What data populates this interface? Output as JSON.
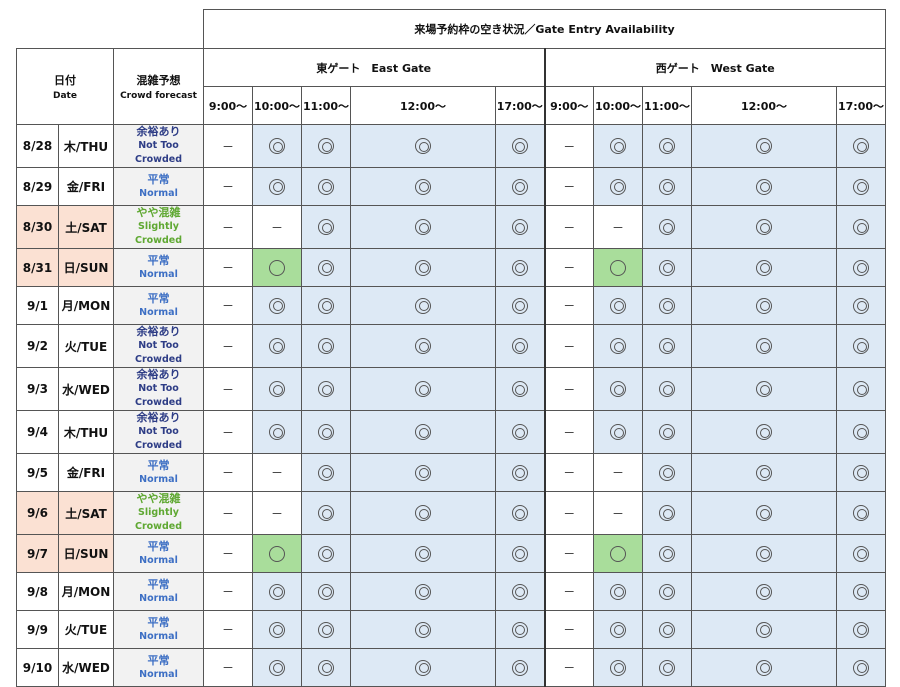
{
  "table": {
    "title": "来場予約枠の空き状況／Gate Entry Availability",
    "header": {
      "date_jp": "日付",
      "date_en": "Date",
      "forecast_jp": "混雑予想",
      "forecast_en": "Crowd forecast"
    },
    "gates": [
      {
        "label": "東ゲート　East Gate"
      },
      {
        "label": "西ゲート　West Gate"
      }
    ],
    "time_slots": [
      "9:00～",
      "10:00～",
      "11:00～",
      "12:00～",
      "17:00～"
    ],
    "legend_symbols": {
      "double_circle": "◎",
      "circle": "○",
      "dash": "－"
    },
    "rows": [
      {
        "date": "8/28",
        "dow": "木/THU",
        "weekend": false,
        "forecast_jp": "余裕あり",
        "forecast_en": "Not Too Crowded",
        "forecast_level": "relaxed",
        "east": [
          "dash",
          "double_circle",
          "double_circle",
          "double_circle",
          "double_circle"
        ],
        "west": [
          "dash",
          "double_circle",
          "double_circle",
          "double_circle",
          "double_circle"
        ]
      },
      {
        "date": "8/29",
        "dow": "金/FRI",
        "weekend": false,
        "forecast_jp": "平常",
        "forecast_en": "Normal",
        "forecast_level": "normal",
        "east": [
          "dash",
          "double_circle",
          "double_circle",
          "double_circle",
          "double_circle"
        ],
        "west": [
          "dash",
          "double_circle",
          "double_circle",
          "double_circle",
          "double_circle"
        ]
      },
      {
        "date": "8/30",
        "dow": "土/SAT",
        "weekend": true,
        "forecast_jp": "やや混雑",
        "forecast_en": "Slightly Crowded",
        "forecast_level": "slight",
        "east": [
          "dash",
          "dash",
          "double_circle",
          "double_circle",
          "double_circle"
        ],
        "west": [
          "dash",
          "dash",
          "double_circle",
          "double_circle",
          "double_circle"
        ]
      },
      {
        "date": "8/31",
        "dow": "日/SUN",
        "weekend": true,
        "forecast_jp": "平常",
        "forecast_en": "Normal",
        "forecast_level": "normal",
        "east": [
          "dash",
          "circle",
          "double_circle",
          "double_circle",
          "double_circle"
        ],
        "west": [
          "dash",
          "circle",
          "double_circle",
          "double_circle",
          "double_circle"
        ]
      },
      {
        "date": "9/1",
        "dow": "月/MON",
        "weekend": false,
        "forecast_jp": "平常",
        "forecast_en": "Normal",
        "forecast_level": "normal",
        "east": [
          "dash",
          "double_circle",
          "double_circle",
          "double_circle",
          "double_circle"
        ],
        "west": [
          "dash",
          "double_circle",
          "double_circle",
          "double_circle",
          "double_circle"
        ]
      },
      {
        "date": "9/2",
        "dow": "火/TUE",
        "weekend": false,
        "forecast_jp": "余裕あり",
        "forecast_en": "Not Too Crowded",
        "forecast_level": "relaxed",
        "east": [
          "dash",
          "double_circle",
          "double_circle",
          "double_circle",
          "double_circle"
        ],
        "west": [
          "dash",
          "double_circle",
          "double_circle",
          "double_circle",
          "double_circle"
        ]
      },
      {
        "date": "9/3",
        "dow": "水/WED",
        "weekend": false,
        "forecast_jp": "余裕あり",
        "forecast_en": "Not Too Crowded",
        "forecast_level": "relaxed",
        "east": [
          "dash",
          "double_circle",
          "double_circle",
          "double_circle",
          "double_circle"
        ],
        "west": [
          "dash",
          "double_circle",
          "double_circle",
          "double_circle",
          "double_circle"
        ]
      },
      {
        "date": "9/4",
        "dow": "木/THU",
        "weekend": false,
        "forecast_jp": "余裕あり",
        "forecast_en": "Not Too Crowded",
        "forecast_level": "relaxed",
        "east": [
          "dash",
          "double_circle",
          "double_circle",
          "double_circle",
          "double_circle"
        ],
        "west": [
          "dash",
          "double_circle",
          "double_circle",
          "double_circle",
          "double_circle"
        ]
      },
      {
        "date": "9/5",
        "dow": "金/FRI",
        "weekend": false,
        "forecast_jp": "平常",
        "forecast_en": "Normal",
        "forecast_level": "normal",
        "east": [
          "dash",
          "dash",
          "double_circle",
          "double_circle",
          "double_circle"
        ],
        "west": [
          "dash",
          "dash",
          "double_circle",
          "double_circle",
          "double_circle"
        ]
      },
      {
        "date": "9/6",
        "dow": "土/SAT",
        "weekend": true,
        "forecast_jp": "やや混雑",
        "forecast_en": "Slightly Crowded",
        "forecast_level": "slight",
        "east": [
          "dash",
          "dash",
          "double_circle",
          "double_circle",
          "double_circle"
        ],
        "west": [
          "dash",
          "dash",
          "double_circle",
          "double_circle",
          "double_circle"
        ]
      },
      {
        "date": "9/7",
        "dow": "日/SUN",
        "weekend": true,
        "forecast_jp": "平常",
        "forecast_en": "Normal",
        "forecast_level": "normal",
        "east": [
          "dash",
          "circle",
          "double_circle",
          "double_circle",
          "double_circle"
        ],
        "west": [
          "dash",
          "circle",
          "double_circle",
          "double_circle",
          "double_circle"
        ]
      },
      {
        "date": "9/8",
        "dow": "月/MON",
        "weekend": false,
        "forecast_jp": "平常",
        "forecast_en": "Normal",
        "forecast_level": "normal",
        "east": [
          "dash",
          "double_circle",
          "double_circle",
          "double_circle",
          "double_circle"
        ],
        "west": [
          "dash",
          "double_circle",
          "double_circle",
          "double_circle",
          "double_circle"
        ]
      },
      {
        "date": "9/9",
        "dow": "火/TUE",
        "weekend": false,
        "forecast_jp": "平常",
        "forecast_en": "Normal",
        "forecast_level": "normal",
        "east": [
          "dash",
          "double_circle",
          "double_circle",
          "double_circle",
          "double_circle"
        ],
        "west": [
          "dash",
          "double_circle",
          "double_circle",
          "double_circle",
          "double_circle"
        ]
      },
      {
        "date": "9/10",
        "dow": "水/WED",
        "weekend": false,
        "forecast_jp": "平常",
        "forecast_en": "Normal",
        "forecast_level": "normal",
        "east": [
          "dash",
          "double_circle",
          "double_circle",
          "double_circle",
          "double_circle"
        ],
        "west": [
          "dash",
          "double_circle",
          "double_circle",
          "double_circle",
          "double_circle"
        ]
      }
    ]
  },
  "colors": {
    "weekend_bg": "#fbe1d3",
    "forecast_bg": "#f2f2f2",
    "available_bg": "#dde9f5",
    "few_left_bg": "#a9dd9b",
    "relaxed_text": "#2e3d86",
    "normal_text": "#3d6fc4",
    "slight_text": "#5fa832"
  }
}
